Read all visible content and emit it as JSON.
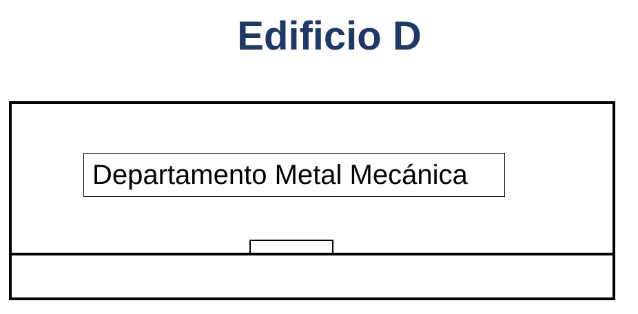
{
  "title": "Edificio D",
  "department_label": "Departamento Metal Mecánica",
  "colors": {
    "title": "#1f3864",
    "lines": "#000000",
    "background": "#ffffff"
  }
}
